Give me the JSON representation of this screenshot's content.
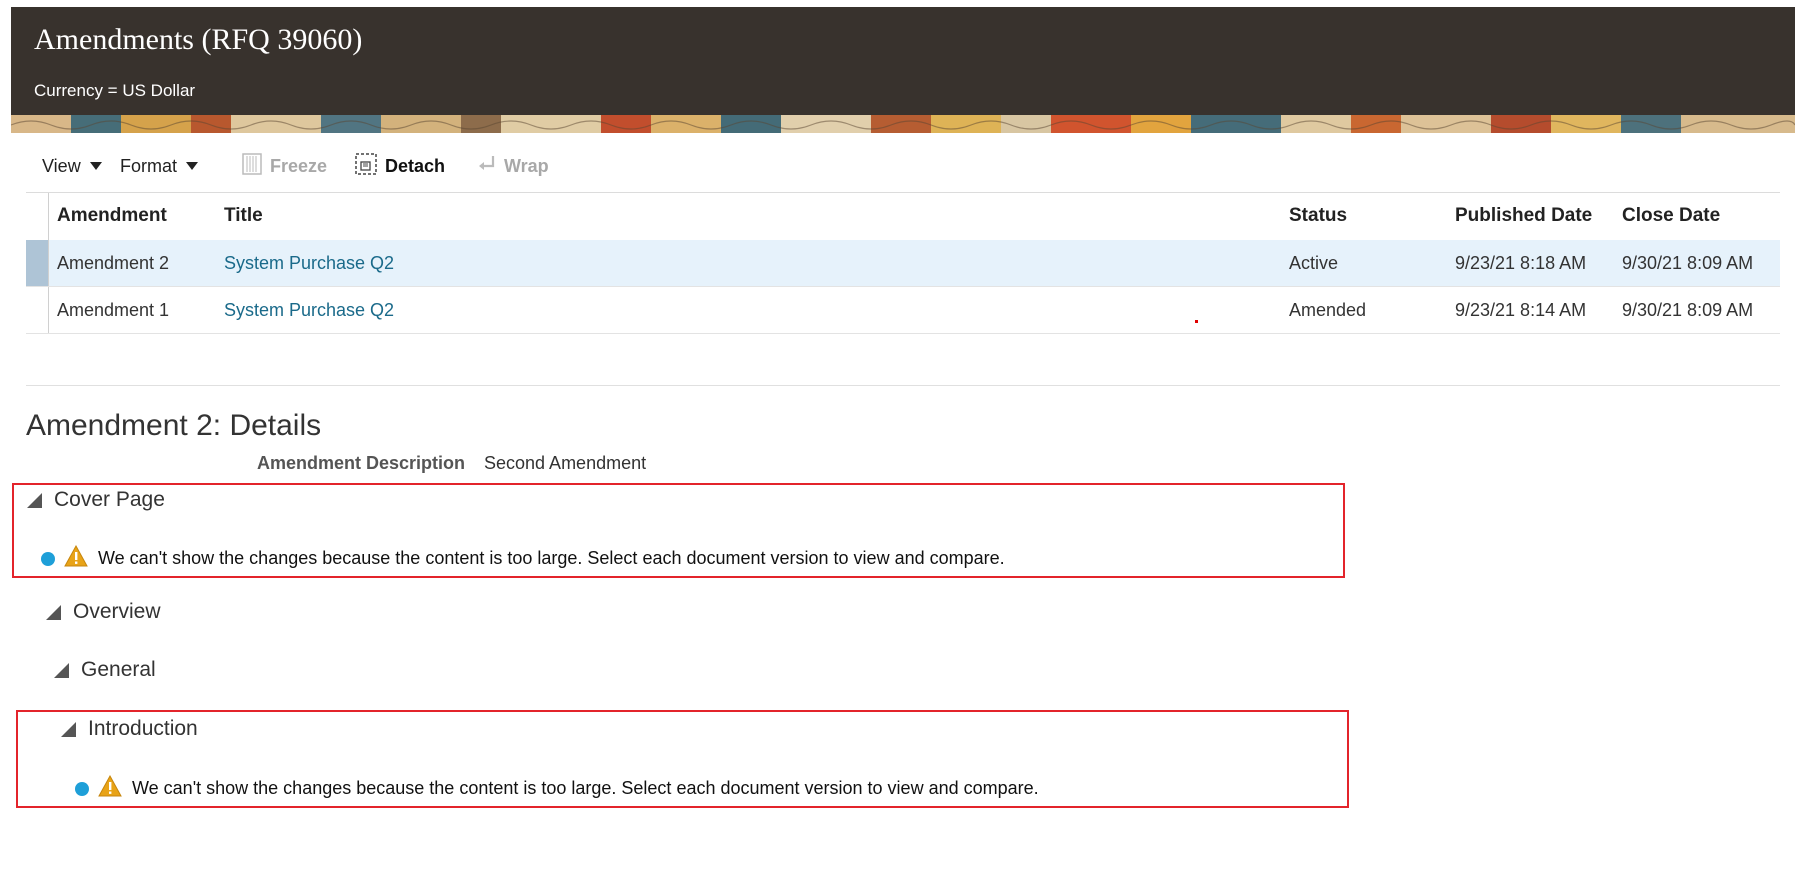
{
  "header": {
    "title": "Amendments (RFQ 39060)",
    "currency": "Currency = US Dollar"
  },
  "toolbar": {
    "view_label": "View",
    "format_label": "Format",
    "freeze_label": "Freeze",
    "detach_label": "Detach",
    "wrap_label": "Wrap"
  },
  "table": {
    "columns": [
      "Amendment",
      "Title",
      "Status",
      "Published Date",
      "Close Date"
    ],
    "rows": [
      {
        "amendment": "Amendment 2",
        "title": "System Purchase Q2",
        "status": "Active",
        "published": "9/23/21 8:18 AM",
        "close": "9/30/21 8:09 AM",
        "selected": true
      },
      {
        "amendment": "Amendment 1",
        "title": "System Purchase Q2",
        "status": "Amended",
        "published": "9/23/21 8:14 AM",
        "close": "9/30/21 8:09 AM",
        "selected": false
      }
    ]
  },
  "details": {
    "title": "Amendment 2: Details",
    "description_label": "Amendment Description",
    "description_value": "Second Amendment"
  },
  "sections": [
    {
      "label": "Cover Page"
    },
    {
      "label": "Overview"
    },
    {
      "label": "General"
    },
    {
      "label": "Introduction"
    }
  ],
  "messages": [
    {
      "text": "We can't show the changes because the content is too large. Select each document version to view and compare."
    },
    {
      "text": "We can't show the changes because the content is too large. Select each document version to view and compare."
    }
  ],
  "colors": {
    "header_bg": "#38322d",
    "link": "#1a6a8a",
    "highlight_box": "#e3242b",
    "selected_row": "#e6f2fb",
    "bullet": "#1e9fd8",
    "warning": "#e8a317"
  },
  "icons": [
    "caret-down-icon",
    "freeze-icon",
    "detach-icon",
    "wrap-icon",
    "expand-triangle-icon",
    "info-bullet-icon",
    "warning-icon"
  ]
}
